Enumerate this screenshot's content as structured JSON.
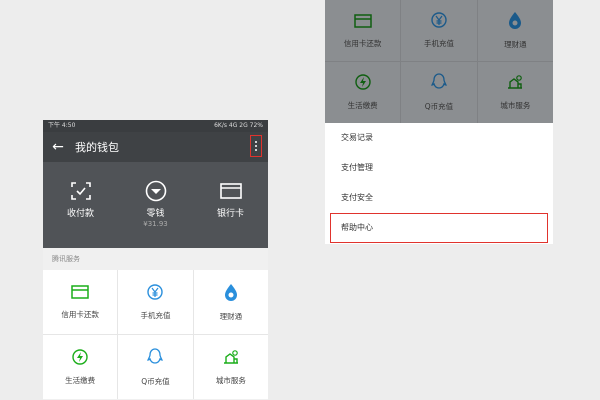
{
  "status_bar": {
    "time": "下午 4:50",
    "indicators": "6K/s  4G  2G  72%"
  },
  "app_bar": {
    "title": "我的钱包",
    "back_icon": "back-arrow-icon",
    "more_icon": "more-vertical-icon"
  },
  "wallet": [
    {
      "label": "收付款",
      "sub": "",
      "icon": "scan-pay-icon"
    },
    {
      "label": "零钱",
      "sub": "¥31.93",
      "icon": "coin-icon"
    },
    {
      "label": "银行卡",
      "sub": "",
      "icon": "bank-card-icon"
    }
  ],
  "services_title": "腾讯服务",
  "services": [
    {
      "label": "信用卡还款",
      "icon": "credit-card-icon"
    },
    {
      "label": "手机充值",
      "icon": "phone-recharge-icon"
    },
    {
      "label": "理财通",
      "icon": "wealth-icon"
    },
    {
      "label": "生活缴费",
      "icon": "utility-icon"
    },
    {
      "label": "Q币充值",
      "icon": "qq-coin-icon"
    },
    {
      "label": "城市服务",
      "icon": "city-icon"
    }
  ],
  "menu": [
    {
      "label": "交易记录"
    },
    {
      "label": "支付管理"
    },
    {
      "label": "支付安全"
    },
    {
      "label": "帮助中心",
      "highlighted": true
    }
  ],
  "colors": {
    "green": "#1aad19",
    "blue": "#2a8fdc",
    "red_highlight": "#e0332d"
  }
}
